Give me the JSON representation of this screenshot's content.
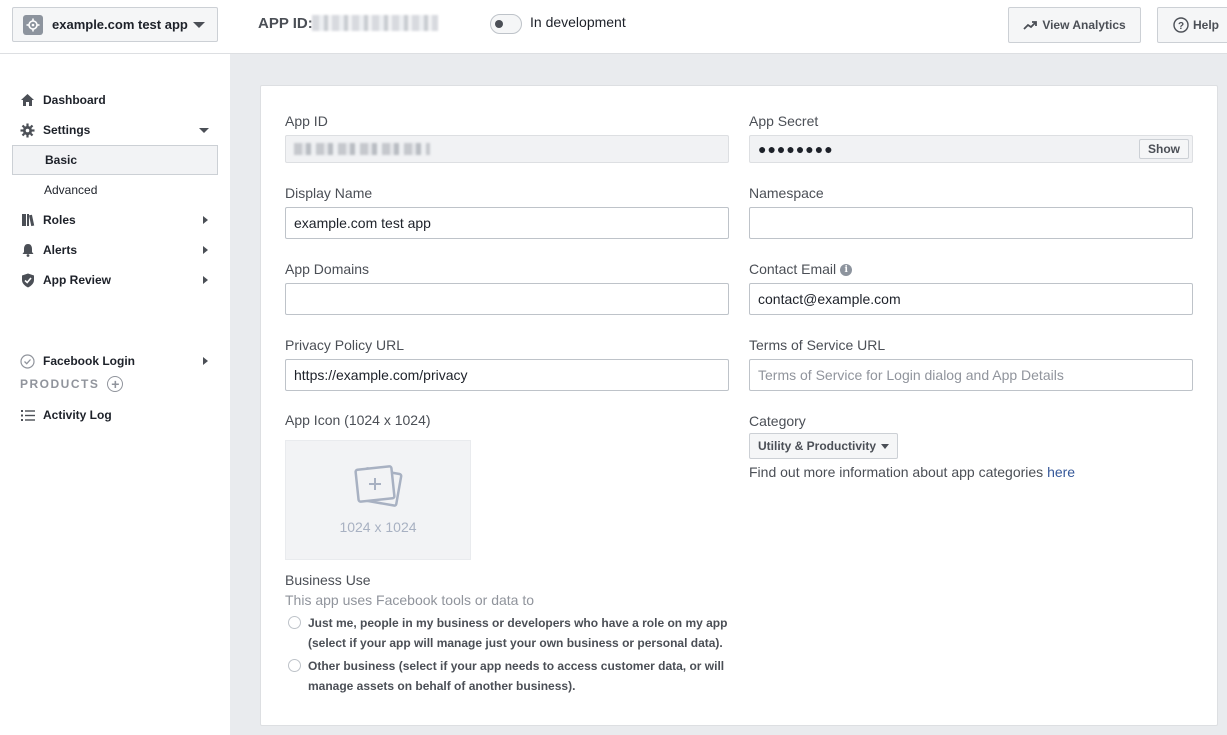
{
  "topbar": {
    "app_name": "example.com test app",
    "app_id_label": "APP ID:",
    "dev_status": "In development",
    "analytics_label": "View Analytics",
    "help_label": "Help"
  },
  "sidebar": {
    "items": [
      {
        "label": "Dashboard"
      },
      {
        "label": "Settings"
      },
      {
        "label": "Basic"
      },
      {
        "label": "Advanced"
      },
      {
        "label": "Roles"
      },
      {
        "label": "Alerts"
      },
      {
        "label": "App Review"
      }
    ],
    "products_heading": "PRODUCTS",
    "products": [
      {
        "label": "Facebook Login"
      }
    ],
    "activity_log": "Activity Log"
  },
  "form": {
    "app_id_label": "App ID",
    "app_secret_label": "App Secret",
    "app_secret_value": "●●●●●●●●",
    "show_label": "Show",
    "display_name_label": "Display Name",
    "display_name_value": "example.com test app",
    "namespace_label": "Namespace",
    "namespace_value": "",
    "app_domains_label": "App Domains",
    "app_domains_value": "",
    "contact_email_label": "Contact Email",
    "contact_email_value": "contact@example.com",
    "privacy_label": "Privacy Policy URL",
    "privacy_value": "https://example.com/privacy",
    "tos_label": "Terms of Service URL",
    "tos_placeholder": "Terms of Service for Login dialog and App Details",
    "app_icon_label": "App Icon (1024 x 1024)",
    "app_icon_size": "1024 x 1024",
    "category_label": "Category",
    "category_value": "Utility & Productivity",
    "category_help": "Find out more information about app categories ",
    "category_link": "here",
    "business_use_label": "Business Use",
    "business_use_sub": "This app uses Facebook tools or data to",
    "business_options": [
      "Just me, people in my business or developers who have a role on my app (select if your app will manage just your own business or personal data).",
      "Other business (select if your app needs to access customer data, or will manage assets on behalf of another business)."
    ]
  },
  "colors": {
    "link": "#365899",
    "page_bg": "#e9ebee",
    "border": "#bec3c9"
  }
}
